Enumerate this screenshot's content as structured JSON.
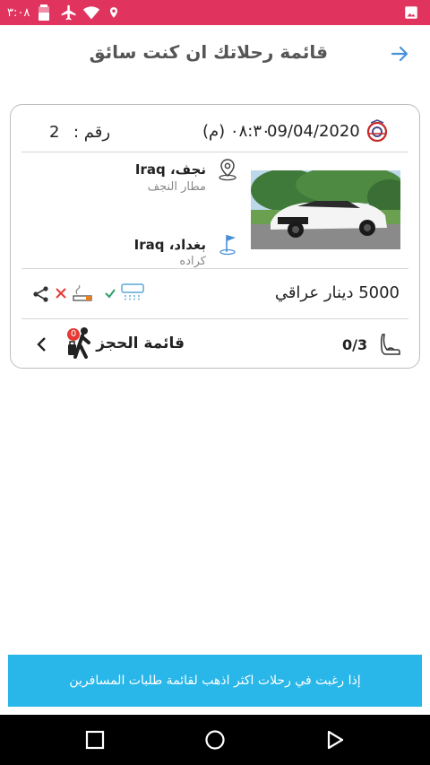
{
  "status_bar": {
    "time": "٣:٠٨",
    "icons": [
      "image-icon",
      "battery-icon",
      "airplane-icon",
      "wifi-icon",
      "location-icon"
    ],
    "background": "#e0345f"
  },
  "header": {
    "title": "قائمة رحلاتك ان كنت سائق",
    "back_icon": "arrow-right-icon"
  },
  "trip": {
    "date": "09/04/2020",
    "time": "٠٨:٣٠ (م)",
    "number_label": "رقم :",
    "number": "2",
    "from": {
      "city": "نجف، Iraq",
      "place": "مطار النجف"
    },
    "to": {
      "city": "بغداد، Iraq",
      "place": "كراده"
    },
    "price": "5000 دينار عراقي",
    "amenities": [
      "air-conditioning-icon",
      "check-icon",
      "smoking-icon",
      "x-icon"
    ],
    "seats": "0/3",
    "booking_label": "قائمة الحجز",
    "booking_badge": "0"
  },
  "footer": {
    "cta_label": "إذا رغبت في رحلات اكثر اذهب لقائمة طلبات المسافرين",
    "cta_color": "#29b6e8"
  },
  "nav_bar": {
    "buttons": [
      "recent-apps-icon",
      "home-icon",
      "back-icon"
    ]
  }
}
